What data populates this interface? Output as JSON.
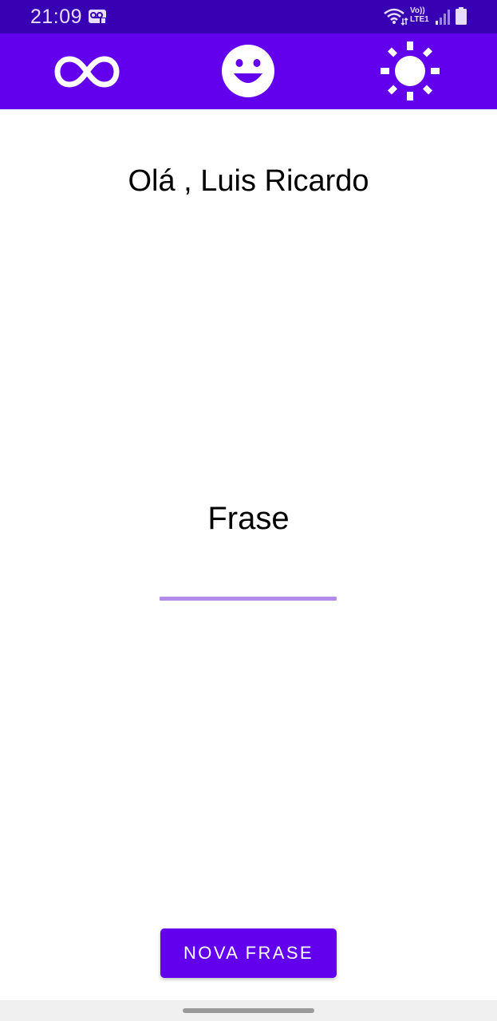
{
  "status_bar": {
    "time": "21:09",
    "network_line1": "Vo))",
    "network_line2": "LTE1",
    "icons": [
      "voicemail-icon",
      "wifi-icon",
      "lte-icon",
      "signal-icon",
      "battery-icon"
    ]
  },
  "app_bar": {
    "background": "#6200ee",
    "buttons": [
      "infinity-icon",
      "smile-icon",
      "sun-icon"
    ]
  },
  "main": {
    "greeting": "Olá , Luis Ricardo",
    "phrase": "Frase"
  },
  "actions": {
    "new_phrase_label": "NOVA FRASE"
  },
  "colors": {
    "status_bar": "#3700b3",
    "primary": "#6200ee",
    "accent_underline": "#b48bea"
  }
}
